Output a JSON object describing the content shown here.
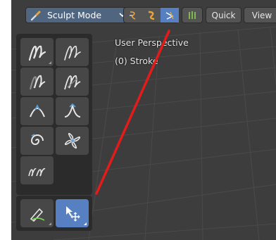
{
  "header": {
    "mode_label": "Sculpt Mode",
    "quick_label": "Quick",
    "view_label": "View"
  },
  "viewport": {
    "perspective_label": "User Perspective",
    "object_label": "(0) Stroke"
  },
  "toolbar": {
    "tools": [
      {
        "name": "draw-brush",
        "icon": "draw-stroke-icon"
      },
      {
        "name": "draw-sharp",
        "icon": "sharp-stroke-icon"
      },
      {
        "name": "smooth",
        "icon": "smooth-stroke-icon"
      },
      {
        "name": "crease",
        "icon": "crease-stroke-icon"
      },
      {
        "name": "pinch",
        "icon": "pinch-icon"
      },
      {
        "name": "grab",
        "icon": "grab-icon"
      },
      {
        "name": "twist",
        "icon": "twist-icon"
      },
      {
        "name": "clay",
        "icon": "clay-icon"
      },
      {
        "name": "multi-stroke",
        "icon": "multi-stroke-icon"
      }
    ],
    "bottom_tools": [
      {
        "name": "annotate",
        "icon": "annotate-icon",
        "active": false
      },
      {
        "name": "transform",
        "icon": "transform-icon",
        "active": true
      }
    ]
  },
  "colors": {
    "viewport_bg": "#3d3d3d",
    "panel_bg": "#2b2b2b",
    "button_bg": "#474747",
    "active_blue": "#5680c2",
    "accent_yellow": "#e8a53b",
    "annotation_red": "#e21b1b"
  }
}
